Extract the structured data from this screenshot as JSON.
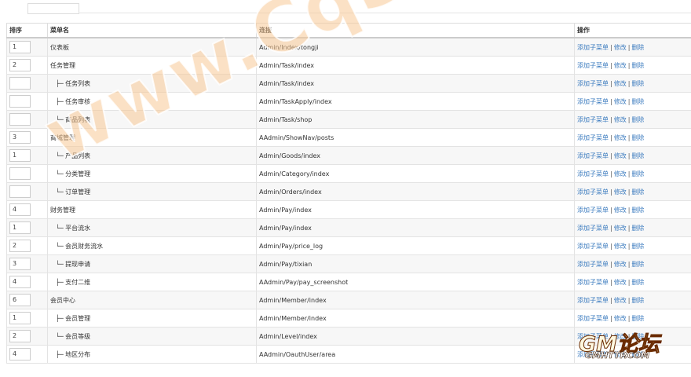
{
  "table": {
    "headers": [
      "排序",
      "菜单名",
      "连接",
      "操作"
    ],
    "rows": [
      {
        "sort": "1",
        "name": "仪表板",
        "sub": false,
        "link": "Admin/Index/tongji"
      },
      {
        "sort": "2",
        "name": "任务管理",
        "sub": false,
        "link": "Admin/Task/index"
      },
      {
        "sort": "",
        "name": "├─ 任务列表",
        "sub": true,
        "link": "Admin/Task/index"
      },
      {
        "sort": "",
        "name": "├─ 任务审核",
        "sub": true,
        "link": "Admin/TaskApply/index"
      },
      {
        "sort": "",
        "name": "└─ 商品列表",
        "sub": true,
        "link": "Admin/Task/shop"
      },
      {
        "sort": "3",
        "name": "商城管理",
        "sub": false,
        "link": "AAdmin/ShowNav/posts"
      },
      {
        "sort": "1",
        "name": "└─ 产品列表",
        "sub": true,
        "link": "Admin/Goods/index"
      },
      {
        "sort": "",
        "name": "└─ 分类管理",
        "sub": true,
        "link": "Admin/Category/index"
      },
      {
        "sort": "",
        "name": "└─ 订单管理",
        "sub": true,
        "link": "Admin/Orders/index"
      },
      {
        "sort": "4",
        "name": "财务管理",
        "sub": false,
        "link": "Admin/Pay/index"
      },
      {
        "sort": "1",
        "name": "└─ 平台流水",
        "sub": true,
        "link": "Admin/Pay/index"
      },
      {
        "sort": "2",
        "name": "└─ 会员财务流水",
        "sub": true,
        "link": "Admin/Pay/price_log"
      },
      {
        "sort": "3",
        "name": "└─ 提现申请",
        "sub": true,
        "link": "Admin/Pay/tixian"
      },
      {
        "sort": "4",
        "name": "├─ 支付二维",
        "sub": true,
        "link": "AAdmin/Pay/pay_screenshot"
      },
      {
        "sort": "6",
        "name": "会员中心",
        "sub": false,
        "link": "Admin/Member/index"
      },
      {
        "sort": "1",
        "name": "├─ 会员管理",
        "sub": true,
        "link": "Admin/Member/index"
      },
      {
        "sort": "2",
        "name": "└─ 会员等级",
        "sub": true,
        "link": "Admin/Level/index"
      },
      {
        "sort": "4",
        "name": "├─ 地区分布",
        "sub": true,
        "link": "AAdmin/OauthUser/area"
      }
    ],
    "actions": {
      "add": "添加子菜单",
      "edit": "修改",
      "delete": "删除",
      "sep": "|"
    }
  },
  "watermark": {
    "text": "www.CqSYBB.Com"
  },
  "logo": {
    "big": "GM论坛",
    "small": "GMHTTP.COM"
  }
}
